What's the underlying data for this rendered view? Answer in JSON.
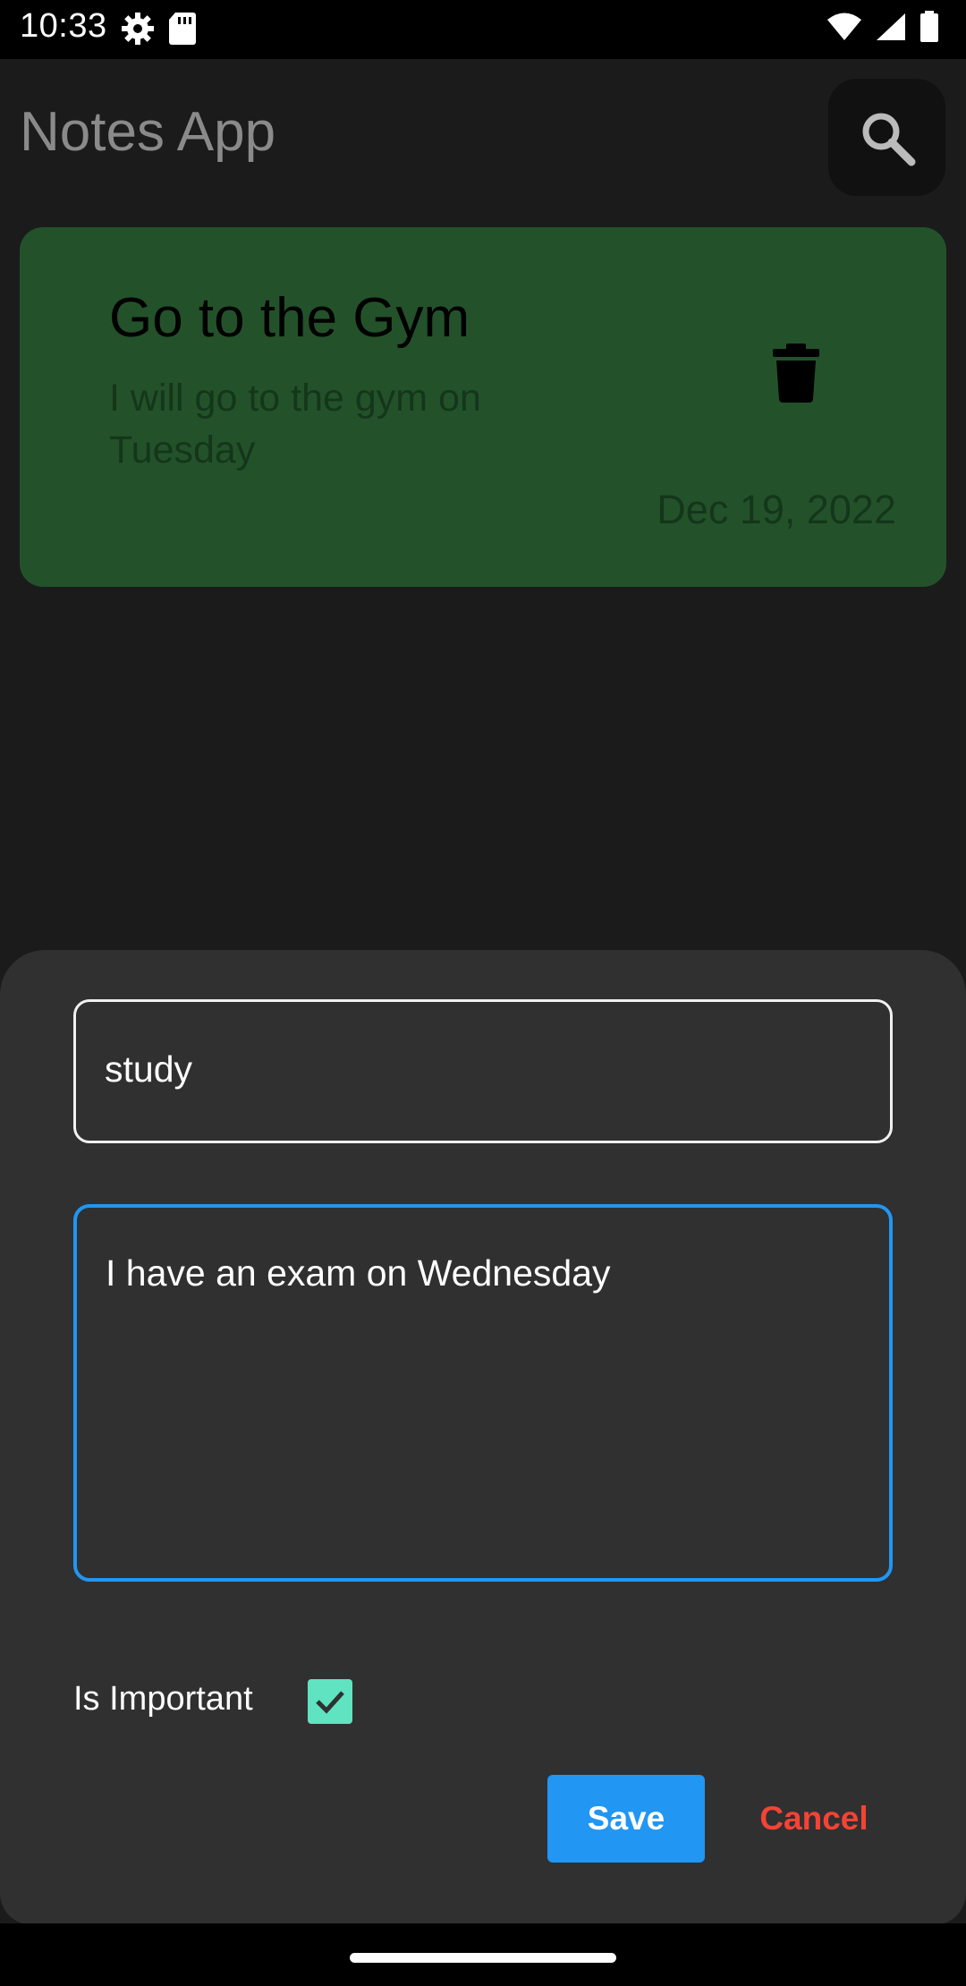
{
  "status_bar": {
    "time": "10:33"
  },
  "app": {
    "title": "Notes App"
  },
  "notes": [
    {
      "title": "Go to the Gym",
      "body": "I will go to the gym on Tuesday",
      "date": "Dec 19, 2022"
    }
  ],
  "dialog": {
    "title_value": "study",
    "body_value": "I have an exam on Wednesday",
    "important_label": "Is Important",
    "important_checked": true,
    "save_label": "Save",
    "cancel_label": "Cancel"
  },
  "colors": {
    "note_card": "#23522a",
    "accent": "#2196f3",
    "checkbox": "#5fe3c0",
    "cancel": "#f44336"
  }
}
